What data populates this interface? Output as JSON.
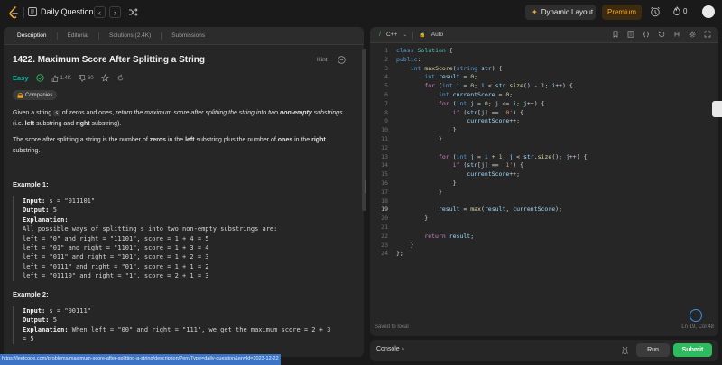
{
  "topbar": {
    "title": "Daily Question",
    "prev_glyph": "‹",
    "next_glyph": "›",
    "dynamic_layout": "Dynamic Layout",
    "premium": "Premium",
    "streak_count": "0"
  },
  "tabs": [
    {
      "label": "Description"
    },
    {
      "label": "Editorial"
    },
    {
      "label": "Solutions (2.4K)"
    },
    {
      "label": "Submissions"
    }
  ],
  "problem": {
    "title": "1422. Maximum Score After Splitting a String",
    "hint": "Hint",
    "difficulty": "Easy",
    "likes": "1.4K",
    "dislikes": "60",
    "companies": "Companies",
    "p1_a": "Given a string ",
    "p1_code": "s",
    "p1_b": " of zeros and ones, ",
    "p1_c": "return the maximum score after splitting the string into two ",
    "p1_d": "non-empty",
    "p1_e": " substrings",
    "p1_f": " (i.e. ",
    "p1_g": "left",
    "p1_h": " substring and ",
    "p1_i": "right",
    "p1_j": " substring).",
    "p2_a": "The score after splitting a string is the number of ",
    "p2_b": "zeros",
    "p2_c": " in the ",
    "p2_d": "left",
    "p2_e": " substring plus the number of ",
    "p2_f": "ones",
    "p2_g": " in the ",
    "p2_h": "right",
    "p2_i": " substring."
  },
  "example1": {
    "heading": "Example 1:",
    "input_label": "Input:",
    "input": " s = \"011101\"",
    "output_label": "Output:",
    "output": " 5",
    "explanation_label": "Explanation:",
    "lines": [
      "All possible ways of splitting s into two non-empty substrings are:",
      "left = \"0\" and right = \"11101\", score = 1 + 4 = 5",
      "left = \"01\" and right = \"1101\", score = 1 + 3 = 4",
      "left = \"011\" and right = \"101\", score = 1 + 2 = 3",
      "left = \"0111\" and right = \"01\", score = 1 + 1 = 2",
      "left = \"01110\" and right = \"1\", score = 2 + 1 = 3"
    ]
  },
  "example2": {
    "heading": "Example 2:",
    "input_label": "Input:",
    "input": " s = \"00111\"",
    "output_label": "Output:",
    "output": " 5",
    "explanation_label": "Explanation:",
    "explanation": " When left = \"00\" and right = \"111\", we get the maximum score = 2 + 3",
    "explanation_cont": "= 5"
  },
  "editor": {
    "language": "C++",
    "mode": "Auto",
    "saved": "Saved to local",
    "cursor": "Ln 19, Col 48",
    "line_numbers": [
      "1",
      "2",
      "3",
      "4",
      "5",
      "6",
      "7",
      "8",
      "9",
      "10",
      "11",
      "12",
      "13",
      "14",
      "15",
      "16",
      "17",
      "18",
      "19",
      "20",
      "21",
      "22",
      "23",
      "24"
    ]
  },
  "console": {
    "label": "Console",
    "run": "Run",
    "submit": "Submit"
  },
  "status_url": "https://leetcode.com/problems/maximum-score-after-splitting-a-string/description/?envType=daily-question&envId=2023-12-22",
  "colors": {
    "easy": "#00b8a3",
    "submit": "#2cbb5d",
    "premium": "#f5a623",
    "status_bar": "#3d73c4"
  }
}
